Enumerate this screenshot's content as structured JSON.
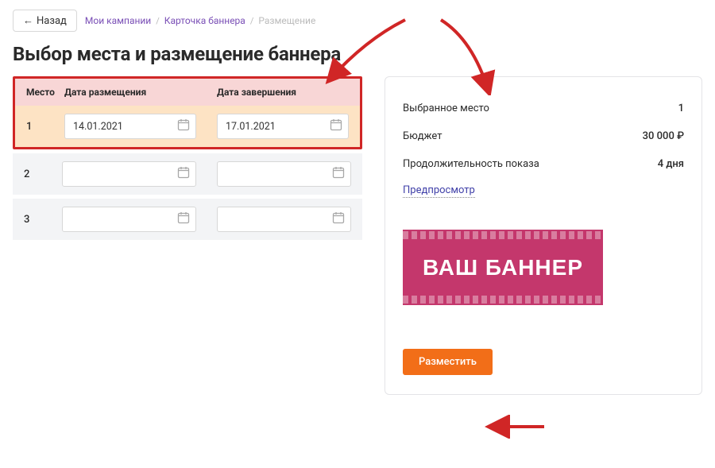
{
  "nav": {
    "back_label": "Назад",
    "crumbs": {
      "my_campaigns": "Мои кампании",
      "banner_card": "Карточка баннера",
      "placement": "Размещение"
    }
  },
  "title": "Выбор места и размещение баннера",
  "table": {
    "head": {
      "place": "Место",
      "date_start": "Дата размещения",
      "date_end": "Дата завершения"
    },
    "rows": [
      {
        "place": "1",
        "start": "14.01.2021",
        "end": "17.01.2021",
        "selected": true
      },
      {
        "place": "2",
        "start": "",
        "end": "",
        "selected": false
      },
      {
        "place": "3",
        "start": "",
        "end": "",
        "selected": false
      }
    ]
  },
  "summary": {
    "place_label": "Выбранное место",
    "place_value": "1",
    "budget_label": "Бюджет",
    "budget_value": "30 000",
    "duration_label": "Продолжительность показа",
    "duration_value": "4 дня",
    "preview_label": "Предпросмотр",
    "banner_text": "ВАШ БАННЕР",
    "place_btn": "Разместить"
  }
}
